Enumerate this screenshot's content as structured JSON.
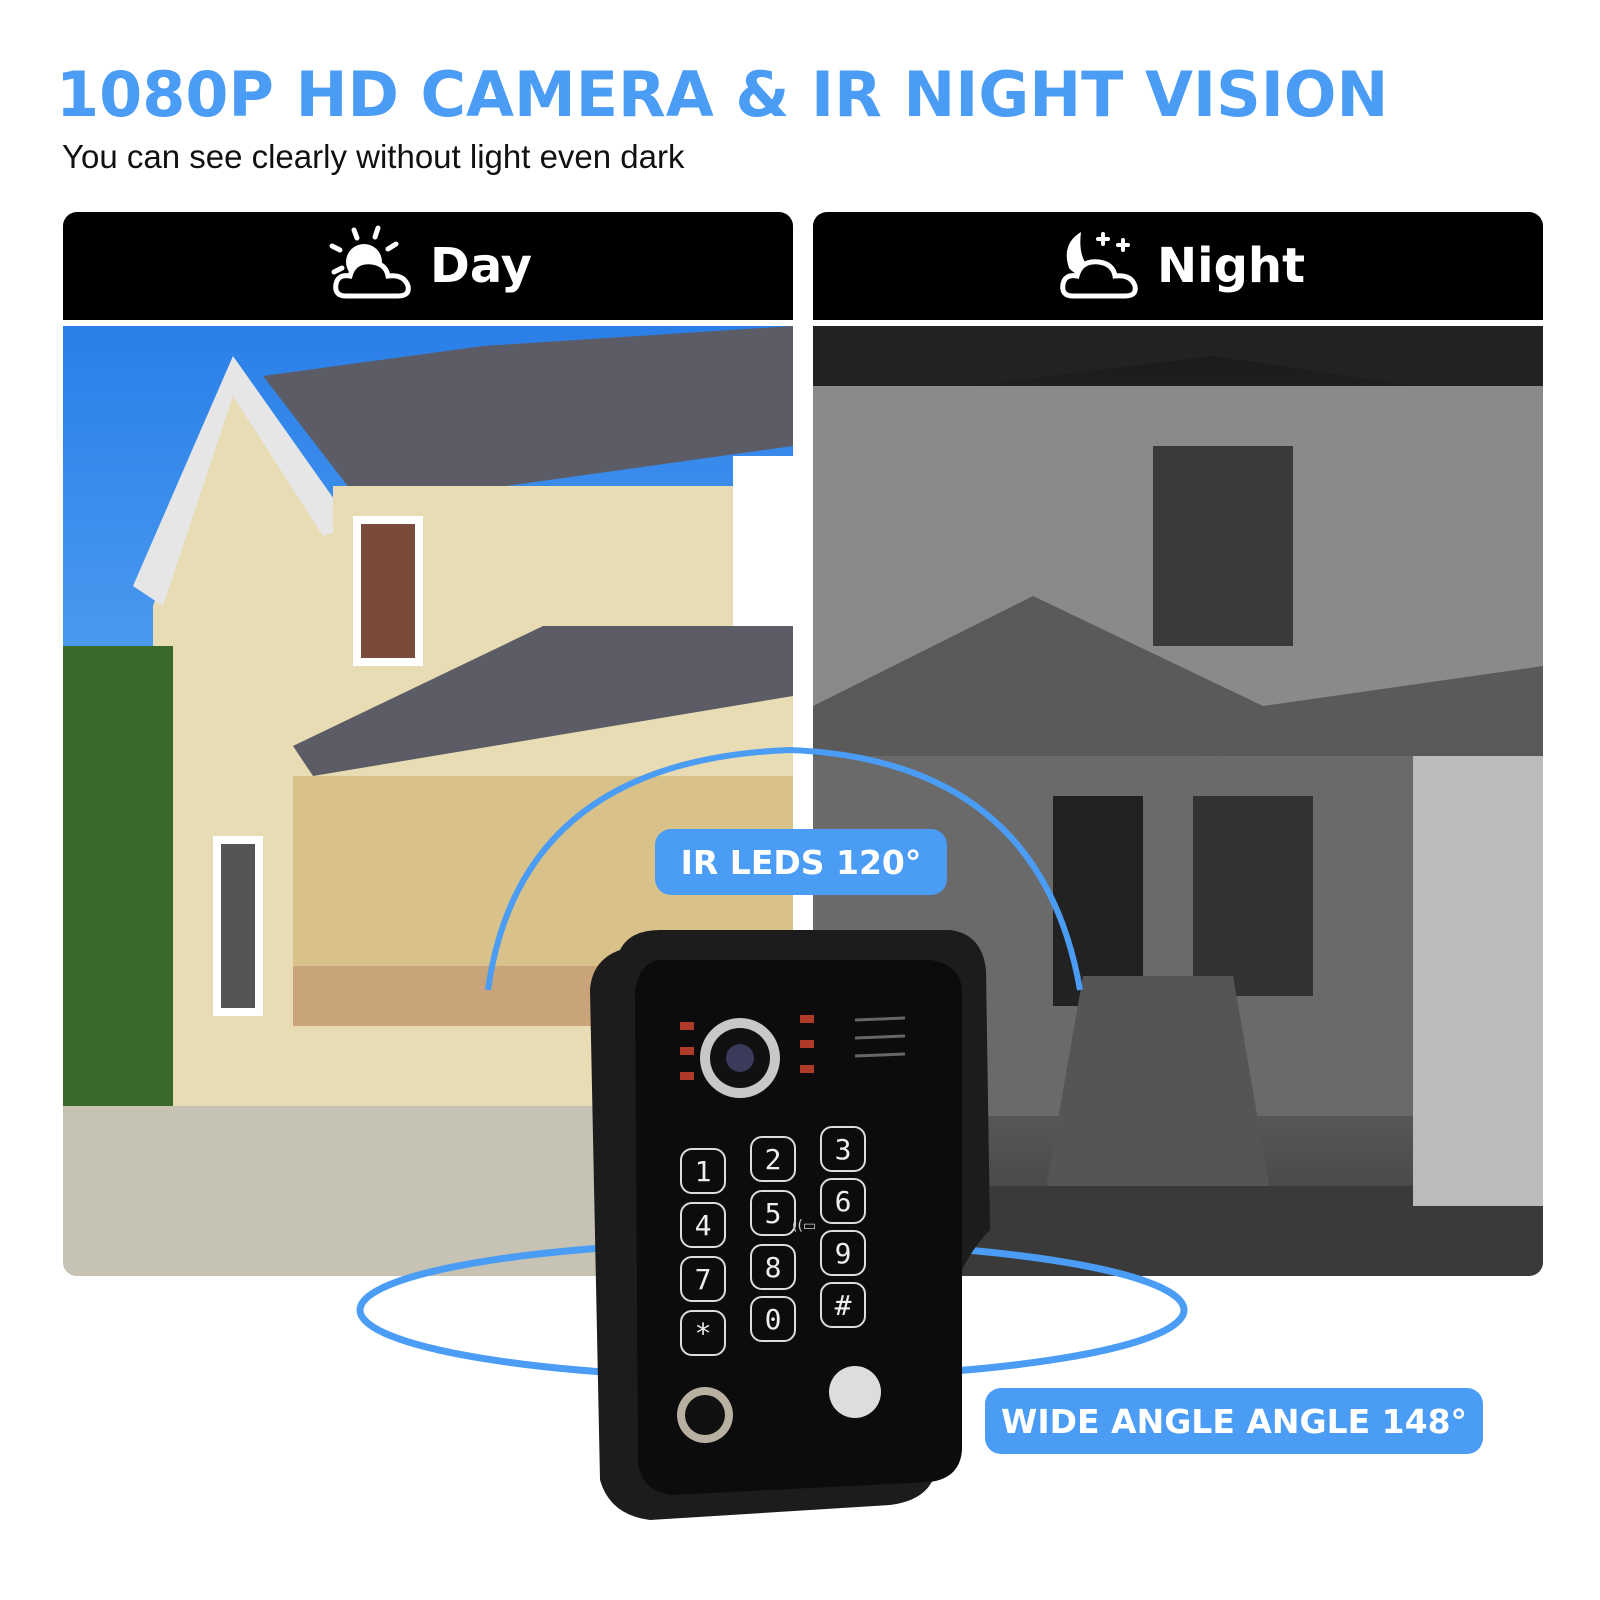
{
  "header": {
    "title": "1080P HD CAMERA & IR NIGHT VISION",
    "subtitle": "You can see clearly without light even dark"
  },
  "panels": [
    {
      "label": "Day",
      "icon": "sun-cloud-icon",
      "mode": "color"
    },
    {
      "label": "Night",
      "icon": "moon-cloud-icon",
      "mode": "grayscale"
    }
  ],
  "badges": {
    "ir_leds": "IR LEDS 120°",
    "wide_angle": "WIDE ANGLE ANGLE 148°"
  },
  "keypad": {
    "keys": [
      "1",
      "2",
      "3",
      "4",
      "5",
      "6",
      "7",
      "8",
      "9",
      "*",
      "0",
      "#"
    ]
  },
  "colors": {
    "accent": "#4a9cf5",
    "header_bg": "#000000",
    "device": "#1a1a1a"
  }
}
